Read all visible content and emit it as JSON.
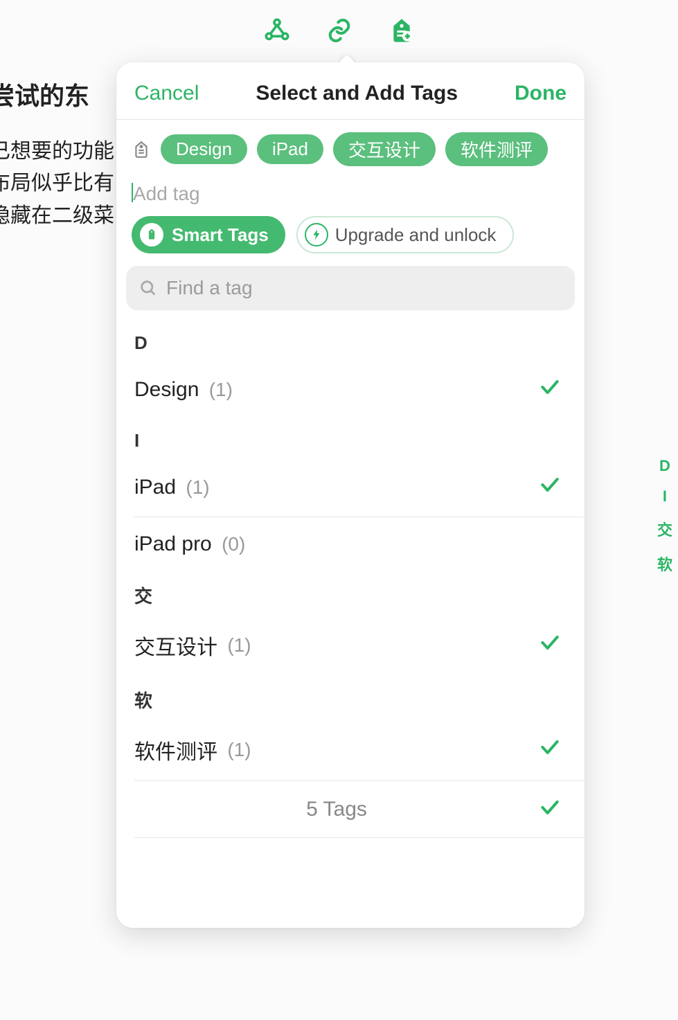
{
  "background": {
    "title": "尝试的东",
    "lines": [
      "已想要的功能",
      "布局似乎比有",
      "隐藏在二级菜"
    ]
  },
  "toolbar": {
    "items": [
      "graph",
      "link",
      "tag"
    ]
  },
  "popover": {
    "cancel": "Cancel",
    "title": "Select and Add Tags",
    "done": "Done",
    "tags": [
      "Design",
      "iPad",
      "交互设计",
      "软件测评"
    ],
    "addTagPlaceholder": "Add tag",
    "smartTagsLabel": "Smart Tags",
    "upgradeLabel": "Upgrade and unlock",
    "searchPlaceholder": "Find a tag",
    "sections": [
      {
        "letter": "D",
        "rows": [
          {
            "name": "Design",
            "count": "(1)",
            "checked": true
          }
        ]
      },
      {
        "letter": "I",
        "rows": [
          {
            "name": "iPad",
            "count": "(1)",
            "checked": true
          },
          {
            "name": "iPad pro",
            "count": "(0)",
            "checked": false
          }
        ]
      },
      {
        "letter": "交",
        "rows": [
          {
            "name": "交互设计",
            "count": "(1)",
            "checked": true
          }
        ]
      },
      {
        "letter": "软",
        "rows": [
          {
            "name": "软件测评",
            "count": "(1)",
            "checked": true
          }
        ]
      }
    ],
    "footer": "5 Tags"
  },
  "indexBar": [
    "D",
    "I",
    "交",
    "软"
  ]
}
